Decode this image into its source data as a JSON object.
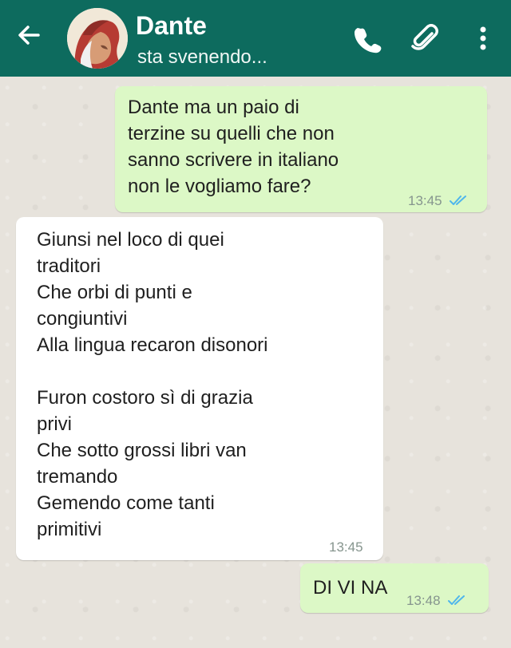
{
  "header": {
    "contact_name": "Dante",
    "status": "sta svenendo..."
  },
  "messages": [
    {
      "direction": "outgoing",
      "text": "Dante ma un paio di\nterzine su quelli che non\nsanno scrivere in italiano\nnon le vogliamo fare?",
      "time": "13:45",
      "status": "read"
    },
    {
      "direction": "incoming",
      "text": "Giunsi nel loco di quei\ntraditori\nChe orbi di punti e\ncongiuntivi\nAlla lingua recaron disonori\n\nFuron costoro sì di grazia\nprivi\nChe sotto grossi libri van\ntremando\nGemendo come tanti\nprimitivi",
      "time": "13:45"
    },
    {
      "direction": "outgoing",
      "text": "DI VI NA",
      "time": "13:48",
      "status": "read"
    }
  ],
  "colors": {
    "header": "#0d6b5e",
    "outgoing_bubble": "#dcf8c6",
    "incoming_bubble": "#ffffff",
    "read_ticks": "#4fb6ec"
  },
  "icons": [
    "back-arrow-icon",
    "phone-icon",
    "paperclip-icon",
    "more-vert-icon",
    "double-check-icon"
  ]
}
